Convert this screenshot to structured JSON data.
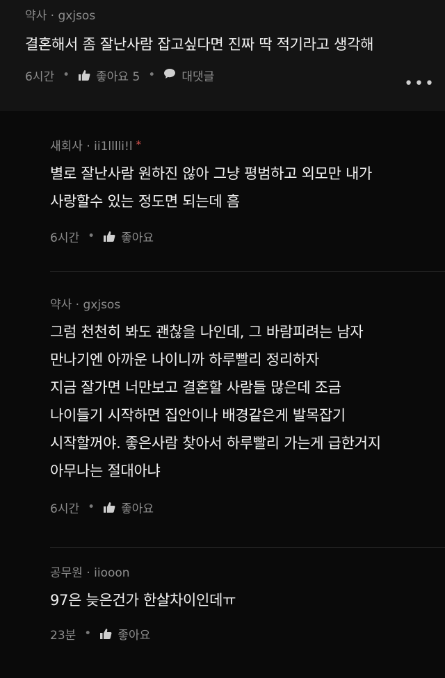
{
  "top_comment": {
    "username": "약사 · gxjsos",
    "text": "결혼해서 좀 잘난사람 잡고싶다면 진짜 딱 적기라고 생각해",
    "time": "6시간",
    "like_label": "좋아요 5",
    "reply_label": "대댓글",
    "more_label": "•••"
  },
  "replies": [
    {
      "username": "새회사 · ii1lllli!l",
      "has_star": true,
      "star": "*",
      "text": "별로 잘난사람 원하진 않아 그냥 평범하고 외모만 내가\n사랑할수 있는 정도면 되는데 흠",
      "time": "6시간",
      "like_label": "좋아요"
    },
    {
      "username": "약사 · gxjsos",
      "has_star": false,
      "text": "그럼 천천히 봐도 괜찮을 나인데, 그 바람피려는 남자\n만나기엔 아까운 나이니까 하루빨리 정리하자\n지금 잘가면 너만보고 결혼할 사람들 많은데 조금\n나이들기 시작하면 집안이나 배경같은게 발목잡기\n시작할꺼야. 좋은사람 찾아서 하루빨리 가는게 급한거지\n아무나는 절대아냐",
      "time": "6시간",
      "like_label": "좋아요"
    },
    {
      "username": "공무원 · iiooon",
      "has_star": false,
      "text": "97은 늦은건가 한살차이인데ㅠ",
      "time": "23분",
      "like_label": "좋아요"
    }
  ],
  "colors": {
    "background": "#0a0a0a",
    "top_comment_bg": "#141414",
    "text": "#f1f1f1",
    "meta": "#8d8d8d",
    "star": "#d9534f"
  },
  "icons": [
    "thumbs-up-icon",
    "speech-bubble-icon",
    "more-icon"
  ]
}
